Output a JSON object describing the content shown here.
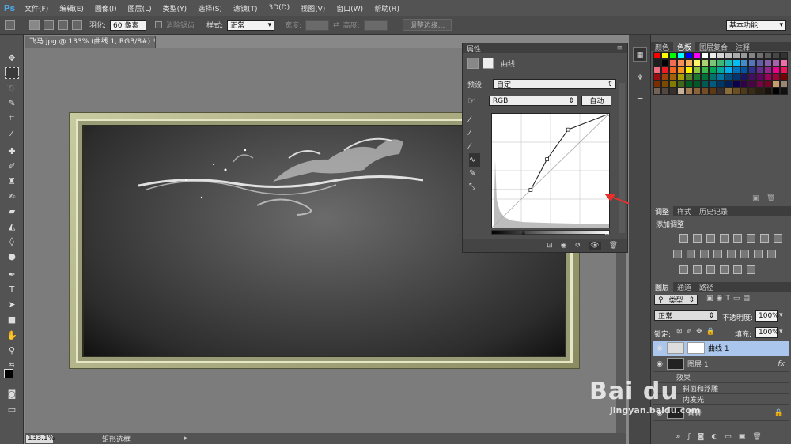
{
  "menubar": {
    "logo": "Ps",
    "items": [
      "文件(F)",
      "编辑(E)",
      "图像(I)",
      "图层(L)",
      "类型(Y)",
      "选择(S)",
      "滤镜(T)",
      "3D(D)",
      "视图(V)",
      "窗口(W)",
      "帮助(H)"
    ]
  },
  "options": {
    "feather_label": "羽化:",
    "feather_value": "60 像素",
    "antialias_label": "消除锯齿",
    "style_label": "样式:",
    "style_value": "正常",
    "width_label": "宽度:",
    "height_label": "高度:",
    "refine_edge": "调整边缘...",
    "workspace": "基本功能"
  },
  "document": {
    "tab_title": "飞马.jpg @ 133% (曲线 1, RGB/8#) *",
    "close_icon": "×",
    "zoom": "133.1%",
    "status": "矩形选框"
  },
  "properties": {
    "title": "属性",
    "curves_label": "曲线",
    "preset_label": "预设:",
    "preset_value": "自定",
    "channel_value": "RGB",
    "auto_button": "自动",
    "curve_points": [
      [
        0,
        0.33
      ],
      [
        0.33,
        0.33
      ],
      [
        0.47,
        0.6
      ],
      [
        0.65,
        0.86
      ],
      [
        1,
        1
      ]
    ]
  },
  "right_panels": {
    "swatch_tabs": [
      "颜色",
      "色板",
      "图层复合",
      "注释"
    ],
    "active_swatch_tab": "色板",
    "swatches": [
      "#ff0000",
      "#ffff00",
      "#00ff00",
      "#00ffff",
      "#0000ff",
      "#ff00ff",
      "#ffffff",
      "#ebebeb",
      "#d6d6d6",
      "#c2c2c2",
      "#adadad",
      "#999999",
      "#858585",
      "#707070",
      "#5c5c5c",
      "#474747",
      "#333333",
      "#1f1f1f",
      "#000000",
      "#f26c4f",
      "#f68e55",
      "#fbaf5c",
      "#fff467",
      "#acd372",
      "#7cc576",
      "#3bb878",
      "#1abbb4",
      "#00bff3",
      "#438ccb",
      "#5574b9",
      "#605ca8",
      "#855fa8",
      "#a763a8",
      "#f06eaa",
      "#f26d7d",
      "#ed1c24",
      "#f26522",
      "#f7941d",
      "#fff200",
      "#8dc73f",
      "#39b54a",
      "#00a651",
      "#00a99d",
      "#00aeef",
      "#0072bc",
      "#0054a6",
      "#2e3192",
      "#662d91",
      "#92278f",
      "#ec008c",
      "#ed145b",
      "#9e0b0f",
      "#a0410d",
      "#a36209",
      "#aba000",
      "#598527",
      "#1a7b30",
      "#007236",
      "#00746b",
      "#0076a3",
      "#004b80",
      "#003471",
      "#1b1464",
      "#440e62",
      "#630460",
      "#9e005d",
      "#9e0039",
      "#790000",
      "#7b2e00",
      "#7d4900",
      "#827b00",
      "#406618",
      "#005e20",
      "#005826",
      "#005952",
      "#005b7f",
      "#003663",
      "#002157",
      "#0d004c",
      "#32004b",
      "#4b0049",
      "#7b0046",
      "#7a0026",
      "#c69c6d",
      "#998675",
      "#736357",
      "#534741",
      "#37302d",
      "#c7b299",
      "#a67c52",
      "#8c6239",
      "#754c24",
      "#603913",
      "#362f2d",
      "#8a6d3b",
      "#6b4e22",
      "#4d3a1a",
      "#3b2a14",
      "#2a1e0f",
      "#1a120a",
      "#000000",
      "#111111"
    ],
    "adj_tabs": [
      "调整",
      "样式",
      "历史记录"
    ],
    "active_adj_tab": "调整",
    "add_adjustment": "添加调整",
    "layer_tabs": [
      "图层",
      "通道",
      "路径"
    ],
    "active_layer_tab": "图层",
    "kind_filter": "类型",
    "blend_mode": "正常",
    "opacity_label": "不透明度:",
    "opacity_value": "100%",
    "lock_label": "锁定:",
    "fill_label": "填充:",
    "fill_value": "100%",
    "layers": [
      {
        "name": "曲线 1",
        "active": true
      },
      {
        "name": "图层 1",
        "active": false
      },
      {
        "name": "效果",
        "active": false
      },
      {
        "name": "斜面和浮雕",
        "active": false
      },
      {
        "name": "内发光",
        "active": false
      },
      {
        "name": "背景",
        "active": false
      }
    ],
    "fx_label": "fx"
  },
  "watermark": {
    "brand": "Bai du",
    "site": "jingyan.baidu.com"
  }
}
